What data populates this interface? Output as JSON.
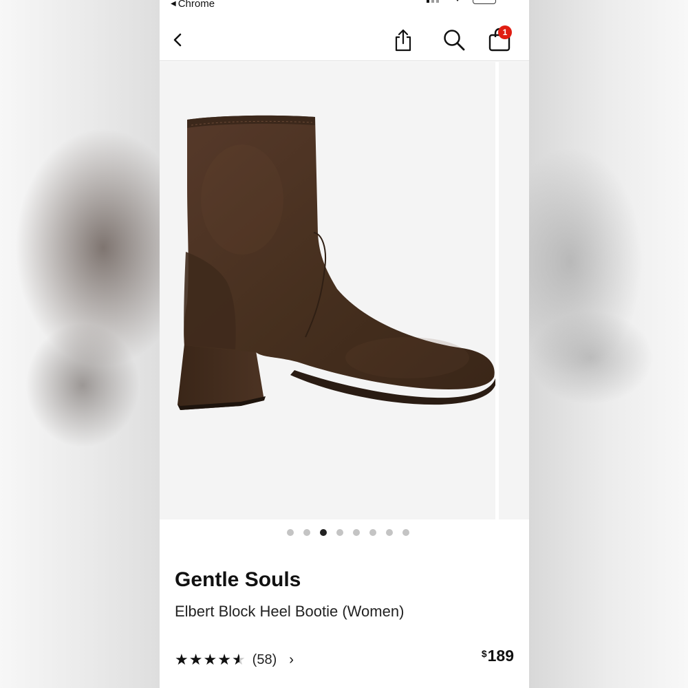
{
  "status_bar": {
    "back_app": "Chrome"
  },
  "nav": {
    "back_icon": "chevron-left-icon",
    "share_icon": "share-icon",
    "search_icon": "search-icon",
    "bag_icon": "shopping-bag-icon",
    "bag_count": "1"
  },
  "carousel": {
    "total": 8,
    "active_index": 2
  },
  "product": {
    "brand": "Gentle Souls",
    "name": "Elbert Block Heel Bootie (Women)",
    "rating": 4.5,
    "review_count": "(58)",
    "currency": "$",
    "price": "189"
  },
  "colors": {
    "badge": "#e01d12",
    "boot": "#4a3221"
  }
}
